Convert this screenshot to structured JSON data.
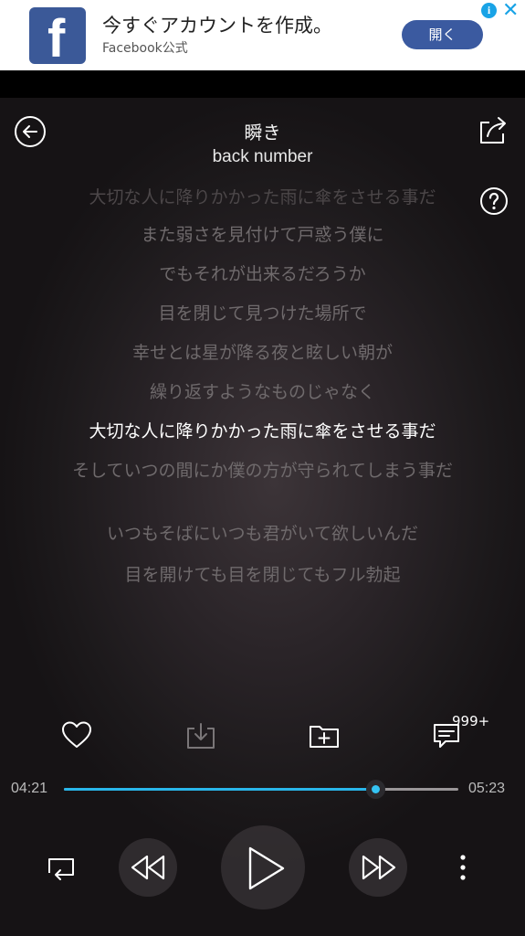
{
  "ad": {
    "title": "今すぐアカウントを作成。",
    "subtitle": "Facebook公式",
    "button_label": "開く",
    "logo_letter": "f",
    "info_glyph": "i",
    "close_glyph": "✕",
    "brand_color": "#3b5998",
    "info_color": "#19a3e6"
  },
  "song": {
    "title": "瞬き",
    "artist": "back number"
  },
  "lyrics": [
    {
      "text": "大切な人に降りかかった雨に傘をさせる事だ",
      "state": "faded"
    },
    {
      "text": "また弱さを見付けて戸惑う僕に",
      "state": "dim"
    },
    {
      "text": "でもそれが出来るだろうか",
      "state": "dim"
    },
    {
      "text": "目を閉じて見つけた場所で",
      "state": "dim"
    },
    {
      "text": "幸せとは星が降る夜と眩しい朝が",
      "state": "dim"
    },
    {
      "text": "繰り返すようなものじゃなく",
      "state": "dim"
    },
    {
      "text": "大切な人に降りかかった雨に傘をさせる事だ",
      "state": "current"
    },
    {
      "text": "そしていつの間にか僕の方が守られてしまう事だ",
      "state": "dim"
    },
    {
      "text": "いつもそばにいつも君がいて欲しいんだ",
      "state": "dim"
    },
    {
      "text": "目を開けても目を閉じてもフル勃起",
      "state": "dim"
    }
  ],
  "actions": {
    "comment_count": "999+"
  },
  "progress": {
    "elapsed": "04:21",
    "total": "05:23",
    "fraction": 0.79,
    "accent_color": "#29b6ea"
  },
  "icons": [
    "back-arrow-icon",
    "share-icon",
    "help-icon",
    "heart-icon",
    "download-icon",
    "add-to-folder-icon",
    "comment-icon",
    "repeat-icon",
    "rewind-icon",
    "play-icon",
    "fast-forward-icon",
    "more-vertical-icon"
  ]
}
